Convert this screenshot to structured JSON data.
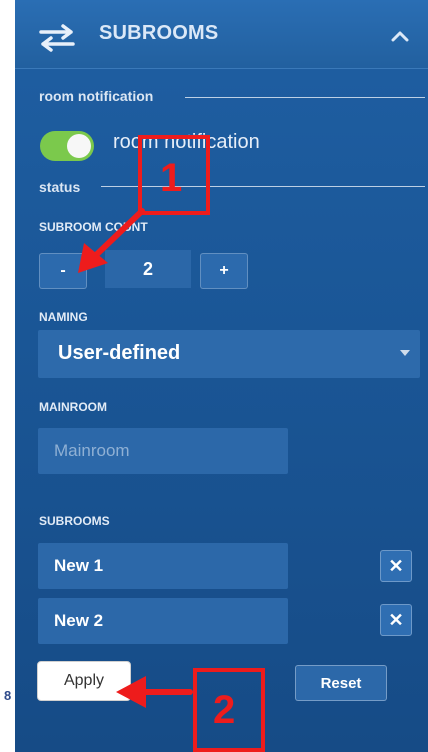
{
  "header": {
    "title": "SUBROOMS"
  },
  "room_notification": {
    "section_label": "room notification",
    "toggle_label": "room notification",
    "toggle_on": true
  },
  "status": {
    "section_label": "status"
  },
  "subroom_count": {
    "label": "SUBROOM COUNT",
    "minus_label": "-",
    "value": "2",
    "plus_label": "+"
  },
  "naming": {
    "label": "NAMING",
    "selected": "User-defined"
  },
  "mainroom": {
    "label": "MAINROOM",
    "placeholder": "Mainroom"
  },
  "subrooms": {
    "label": "SUBROOMS",
    "items": [
      {
        "name": "New 1",
        "remove_label": "✕"
      },
      {
        "name": "New 2",
        "remove_label": "✕"
      }
    ]
  },
  "actions": {
    "apply_label": "Apply",
    "reset_label": "Reset"
  },
  "annotations": {
    "callout_1": "1",
    "callout_2": "2",
    "edge_number": "8"
  },
  "colors": {
    "panel": "#1a5696",
    "toggle_on": "#7bc94c",
    "callout": "#ee1c1c"
  },
  "icons": [
    "swap-arrows-icon",
    "chevron-up-icon",
    "close-icon",
    "arrow-icon"
  ]
}
